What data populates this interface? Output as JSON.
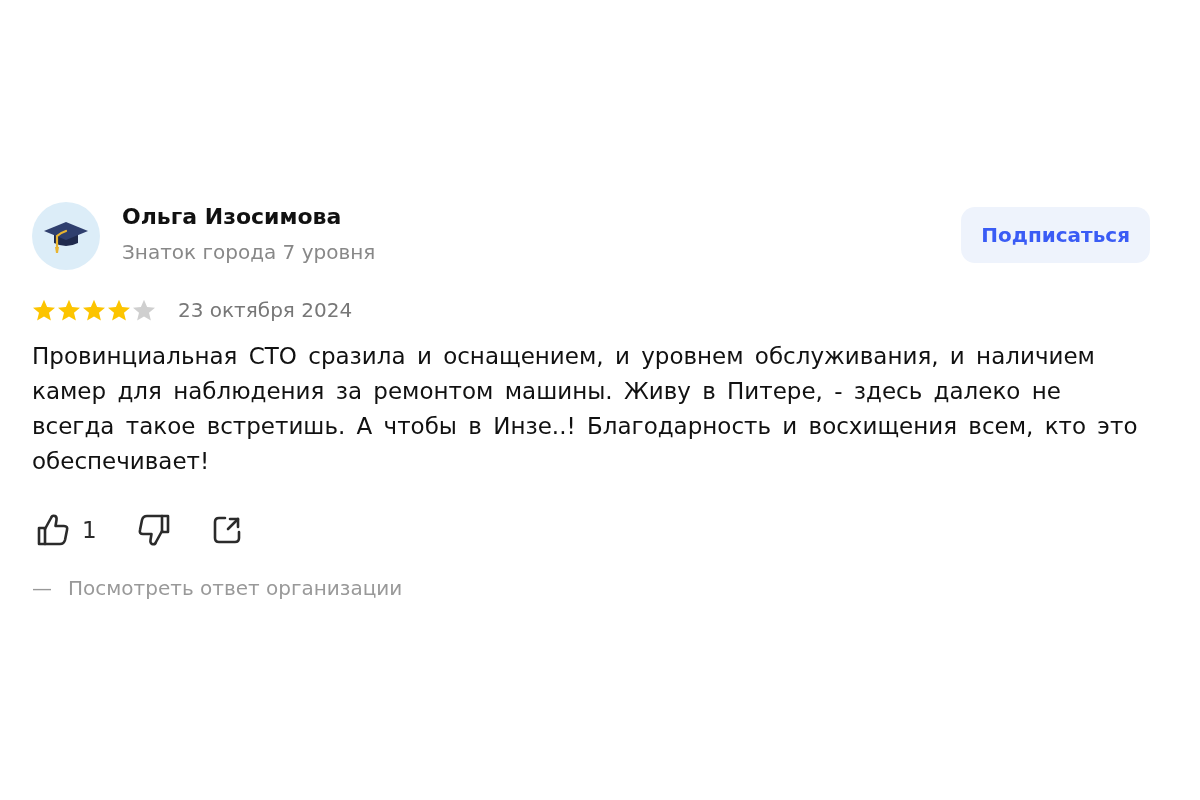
{
  "review": {
    "author": {
      "name": "Ольга Изосимова",
      "level": "Знаток города 7 уровня"
    },
    "subscribe_button": "Подписаться",
    "stars": 4,
    "date": "23 октября 2024",
    "text": "Провинциальная СТО сразила и оснащением, и уровнем обслуживания, и наличием камер для наблюдения за ремонтом машины. Живу в Питере, - здесь далеко не всегда такое встретишь. А чтобы в Инзе..! Благодарность и восхищения всем, кто это обеспечивает!",
    "actions": [
      {
        "kind": "like",
        "count": "1"
      },
      {
        "kind": "dislike"
      },
      {
        "kind": "share"
      }
    ],
    "org_reply_link": {
      "prefix": "—",
      "label": "Посмотреть ответ организации"
    }
  }
}
